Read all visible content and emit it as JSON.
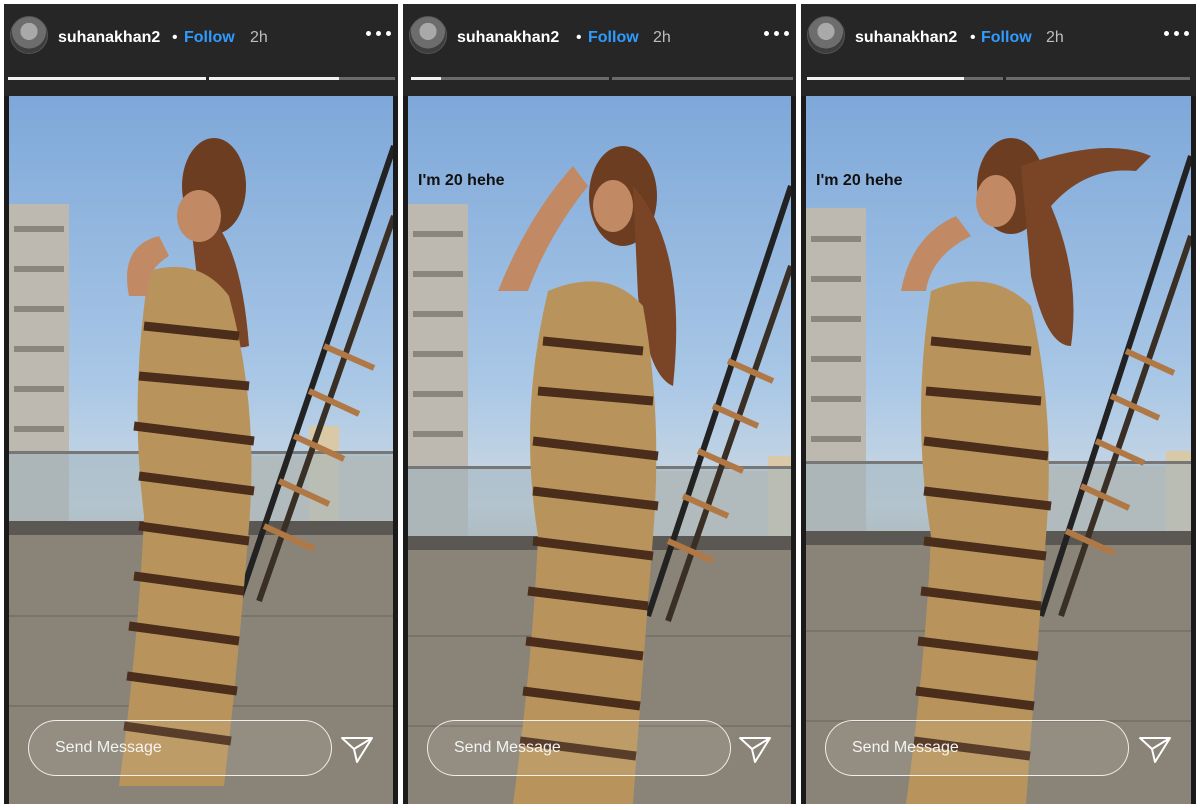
{
  "stories": [
    {
      "username": "suhanakhan2",
      "separator": "•",
      "follow_label": "Follow",
      "time": "2h",
      "caption": "",
      "message_placeholder": "Send Message",
      "progress": [
        1.0,
        0.7
      ]
    },
    {
      "username": "suhanakhan2",
      "separator": "•",
      "follow_label": "Follow",
      "time": "2h",
      "caption": "I'm 20 hehe",
      "message_placeholder": "Send Message",
      "progress": [
        0.15,
        0.0
      ]
    },
    {
      "username": "suhanakhan2",
      "separator": "•",
      "follow_label": "Follow",
      "time": "2h",
      "caption": "I'm 20 hehe",
      "message_placeholder": "Send Message",
      "progress": [
        0.8,
        0.0
      ]
    }
  ],
  "icons": {
    "more": "more-options-icon",
    "send": "paper-plane-icon",
    "avatar": "profile-avatar"
  },
  "colors": {
    "follow": "#2f9bff",
    "header": "#262626",
    "progress_track": "#6a6a6a",
    "progress_fill": "#f2f2f2"
  }
}
